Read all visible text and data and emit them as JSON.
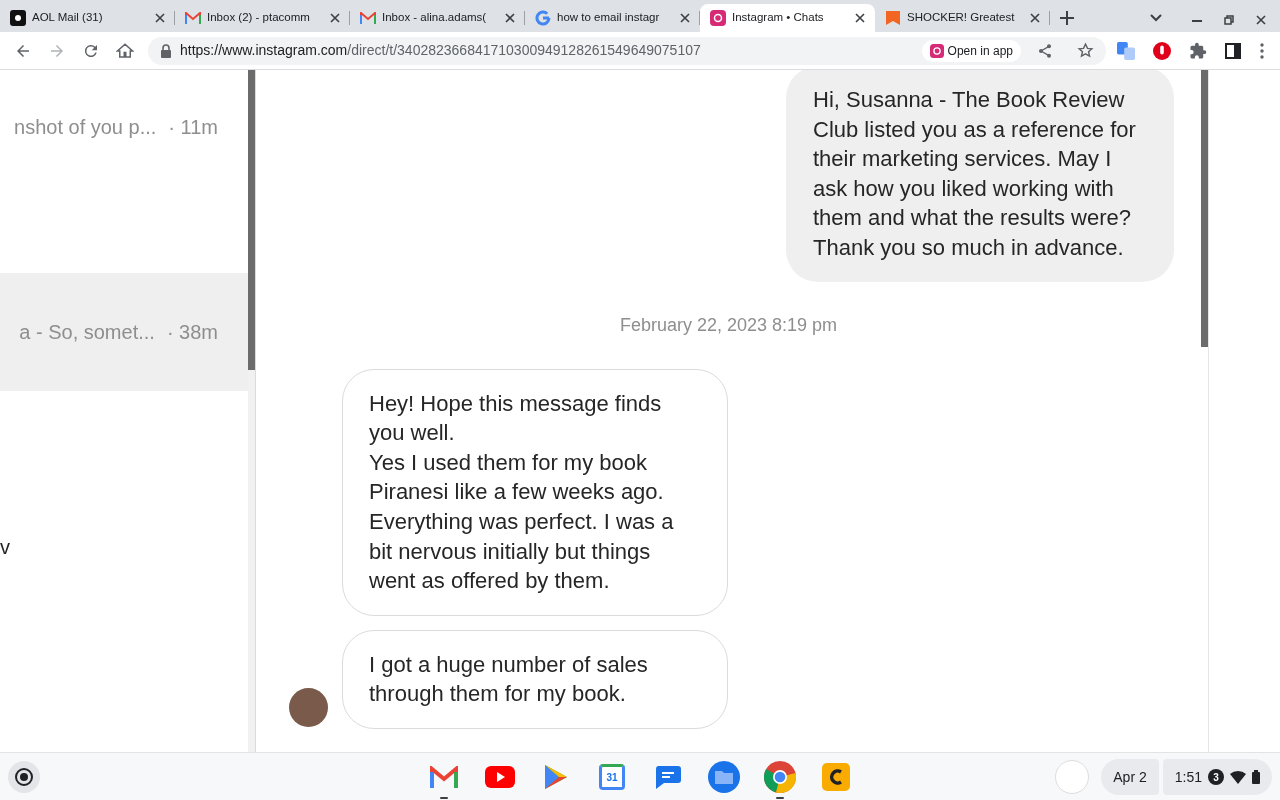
{
  "tabs": [
    {
      "title": "AOL Mail (31)",
      "kind": "aol",
      "selected": false
    },
    {
      "title": "Inbox (2) - ptacomm",
      "kind": "gmail",
      "selected": false
    },
    {
      "title": "Inbox - alina.adams(",
      "kind": "gmail",
      "selected": false
    },
    {
      "title": "how to email instagr",
      "kind": "google",
      "selected": false
    },
    {
      "title": "Instagram • Chats",
      "kind": "instagram",
      "selected": true
    },
    {
      "title": "SHOCKER! Greatest",
      "kind": "bookmark",
      "selected": false
    }
  ],
  "address_bar": {
    "url_host": "https://www.instagram.com",
    "url_path": "/direct/t/340282366841710300949128261549649075107",
    "open_in_app": "Open in app"
  },
  "conversations": [
    {
      "preview": "nshot of you p...",
      "time": "· 11m",
      "selected": false
    },
    {
      "preview": "a - So, somet...",
      "time": "· 38m",
      "selected": true
    }
  ],
  "sidebar_fragment": "v",
  "messages": [
    {
      "kind": "sent",
      "text": "Hi, Susanna - The Book Review Club listed you as a reference for their marketing services. May I ask how you liked working with them and what the results were? Thank you so much in advance."
    },
    {
      "kind": "timestamp",
      "text": "February 22, 2023 8:19 pm"
    },
    {
      "kind": "received",
      "text": "Hey! Hope this message finds you well.\nYes I used them for my book Piranesi like a few weeks ago. Everything was perfect. I was a bit nervous initially but things went as offered by them."
    },
    {
      "kind": "received",
      "text": "I got a huge number of sales through them for my book.",
      "avatar": true
    }
  ],
  "shelf": {
    "apps": [
      {
        "kind": "gmail",
        "running": true
      },
      {
        "kind": "youtube",
        "running": false
      },
      {
        "kind": "play",
        "running": false
      },
      {
        "kind": "calendar",
        "label": "31",
        "running": false
      },
      {
        "kind": "messages",
        "running": false
      },
      {
        "kind": "files",
        "running": false
      },
      {
        "kind": "chrome",
        "running": true
      },
      {
        "kind": "c-app",
        "running": false
      }
    ],
    "date": "Apr 2",
    "time": "1:51",
    "notifications": "3"
  }
}
